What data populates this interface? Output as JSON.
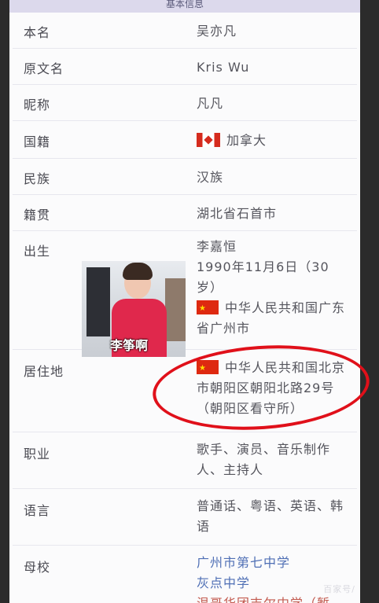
{
  "header": {
    "title": "基本信息"
  },
  "rows": [
    {
      "label": "本名",
      "value": "吴亦凡"
    },
    {
      "label": "原文名",
      "value": "Kris Wu"
    },
    {
      "label": "昵称",
      "value": "凡凡"
    },
    {
      "label": "国籍",
      "value": "加拿大",
      "flag": "canada-flag-icon"
    },
    {
      "label": "民族",
      "value": "汉族"
    },
    {
      "label": "籍贯",
      "value": "湖北省石首市"
    },
    {
      "label": "出生",
      "value_name": "李嘉恒",
      "value_date": "1990年11月6日（30岁）",
      "value_place": "中华人民共和国广东省广州市",
      "flag": "china-flag-icon"
    },
    {
      "label": "居住地",
      "value": "中华人民共和国北京市朝阳区朝阳北路29号（朝阳区看守所）",
      "flag": "china-flag-icon"
    },
    {
      "label": "职业",
      "value": "歌手、演员、音乐制作人、主持人"
    },
    {
      "label": "语言",
      "value": "普通话、粤语、英语、韩语"
    },
    {
      "label": "母校",
      "value_line1": "广州市第七中学",
      "value_line2": "灰点中学",
      "value_line3": "温哥华团吉尔中学（暂"
    }
  ],
  "photo": {
    "caption": "李筝啊"
  },
  "watermark": "百家号/"
}
